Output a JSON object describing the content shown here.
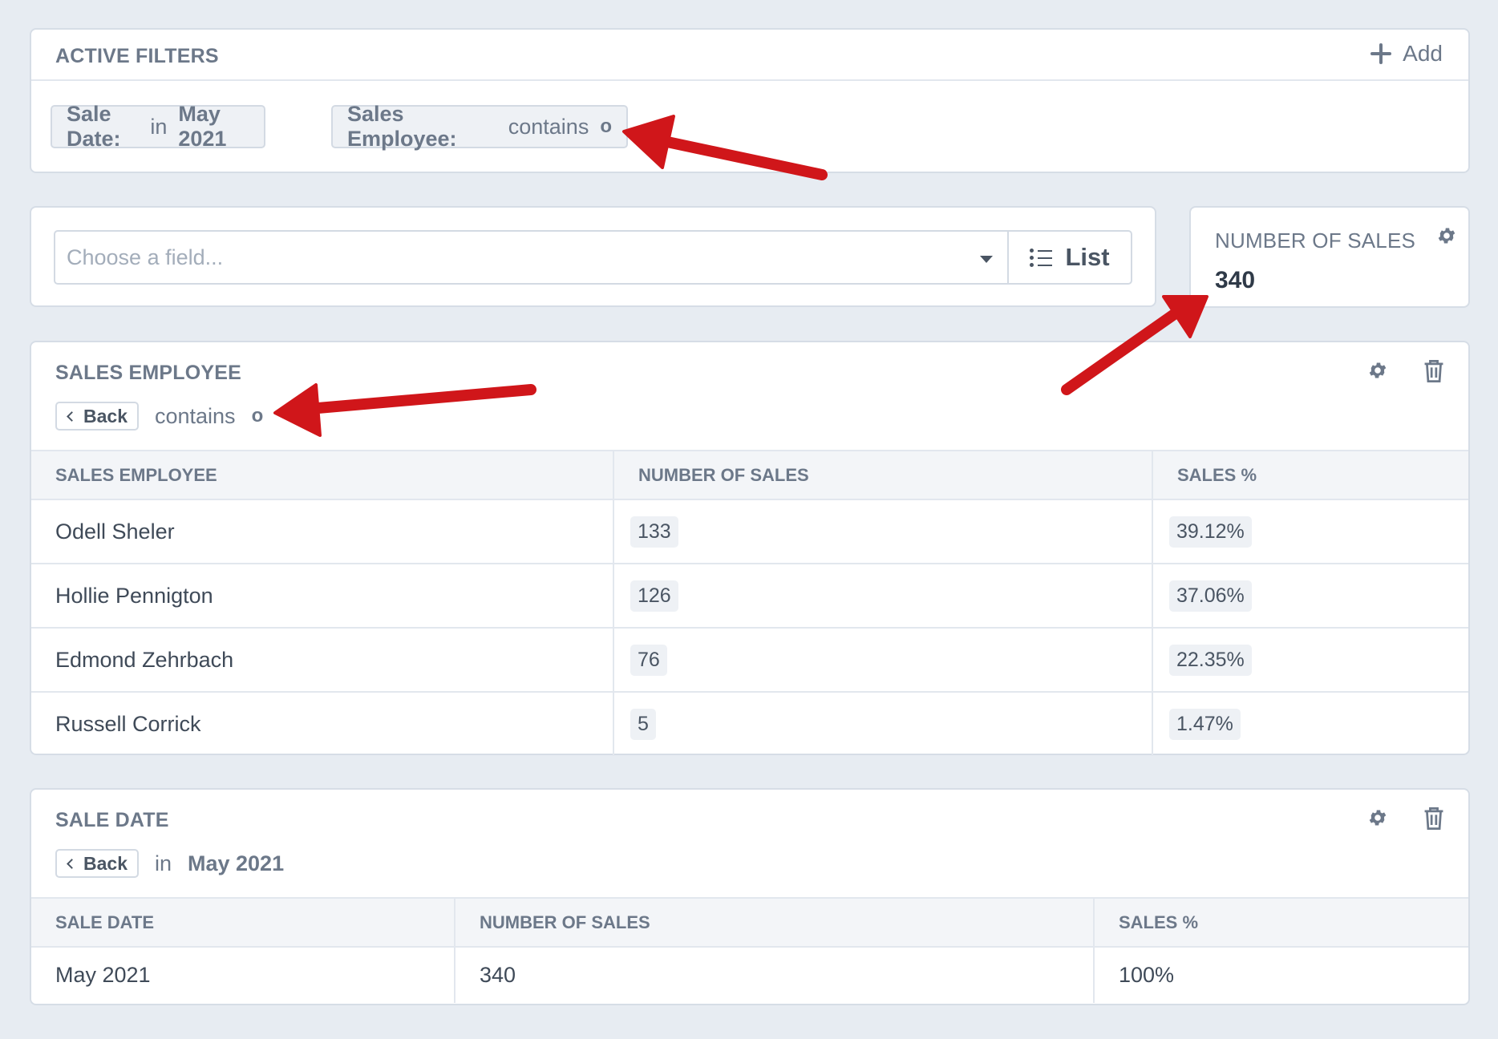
{
  "filters": {
    "title": "ACTIVE FILTERS",
    "add_label": "Add",
    "chips": [
      {
        "field": "Sale Date:",
        "op": "in",
        "value": "May 2021"
      },
      {
        "field": "Sales Employee:",
        "op": "contains",
        "value": "o"
      }
    ]
  },
  "chooser": {
    "placeholder": "Choose a field...",
    "list_label": "List"
  },
  "kpi": {
    "title": "NUMBER OF SALES",
    "value": "340"
  },
  "employee_panel": {
    "title": "SALES EMPLOYEE",
    "back_label": "Back",
    "op": "contains",
    "value": "o",
    "columns": [
      "SALES EMPLOYEE",
      "NUMBER OF SALES",
      "SALES %"
    ],
    "rows": [
      {
        "name": "Odell Sheler",
        "count": "133",
        "pct": "39.12%"
      },
      {
        "name": "Hollie Pennigton",
        "count": "126",
        "pct": "37.06%"
      },
      {
        "name": "Edmond Zehrbach",
        "count": "76",
        "pct": "22.35%"
      },
      {
        "name": "Russell Corrick",
        "count": "5",
        "pct": "1.47%"
      }
    ]
  },
  "date_panel": {
    "title": "SALE DATE",
    "back_label": "Back",
    "op": "in",
    "value": "May 2021",
    "columns": [
      "SALE DATE",
      "NUMBER OF SALES",
      "SALES %"
    ],
    "rows": [
      {
        "date": "May 2021",
        "count": "340",
        "pct": "100%"
      }
    ]
  },
  "colors": {
    "background": "#e7ecf2",
    "muted_text": "#6c7889",
    "annotation_arrow": "#d0161a"
  }
}
